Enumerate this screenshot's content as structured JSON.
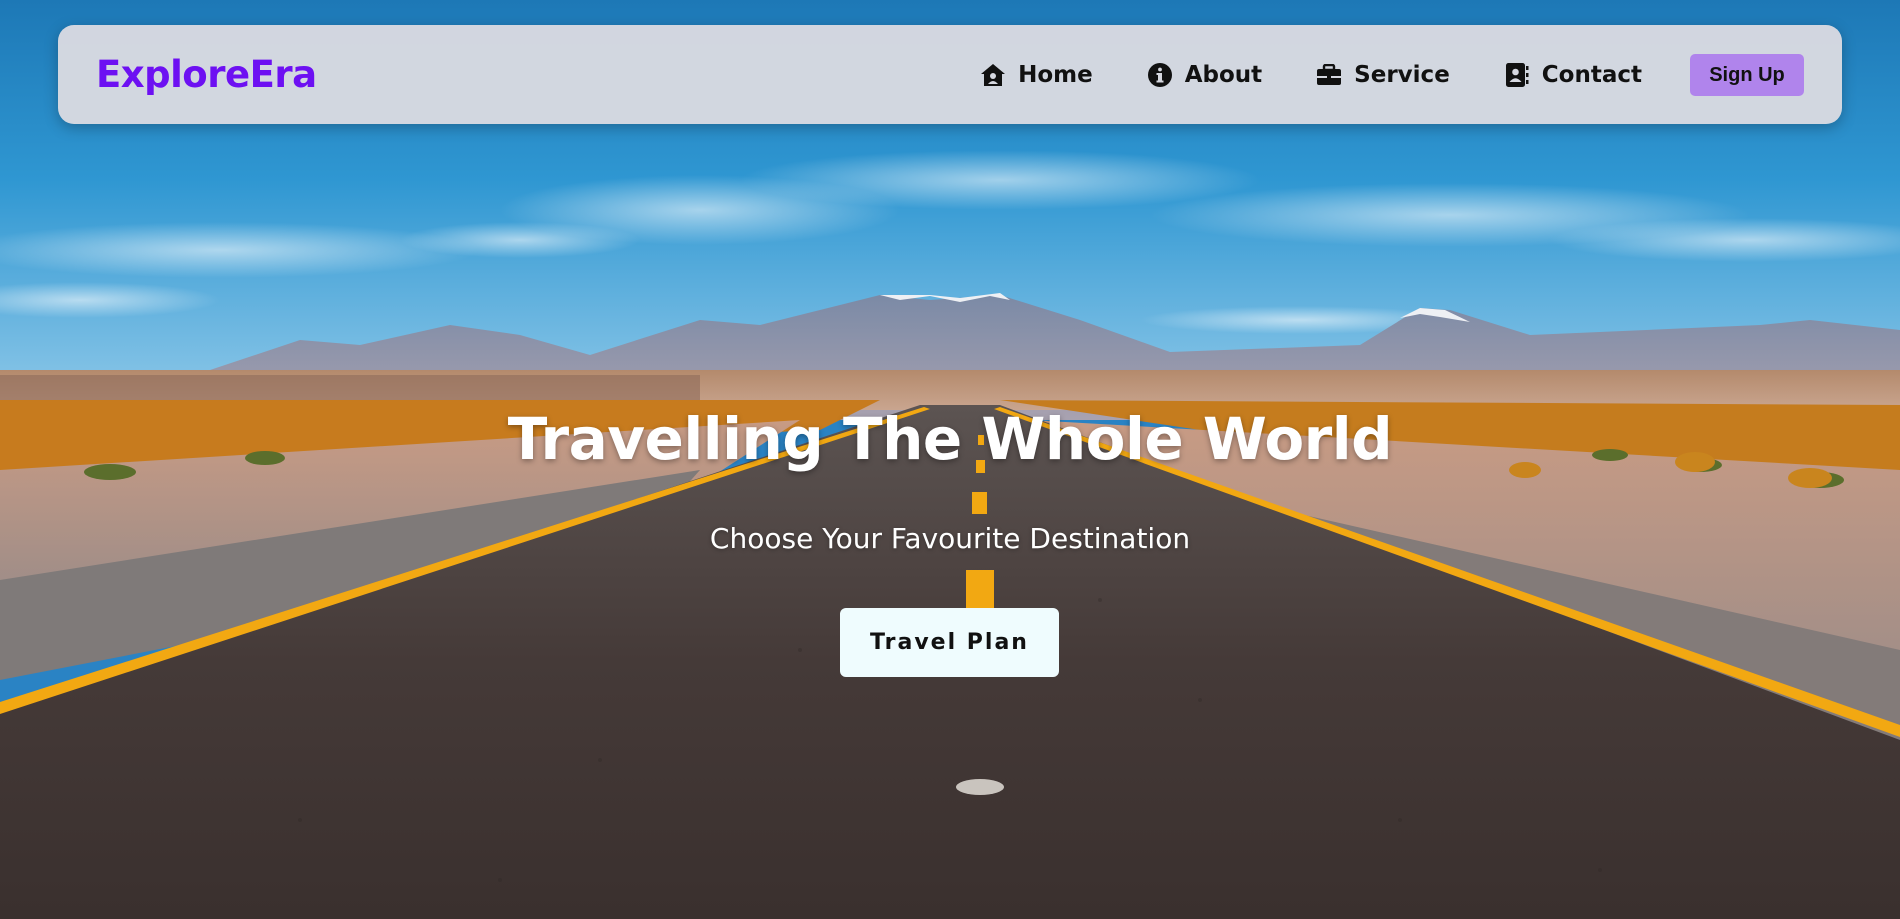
{
  "navbar": {
    "brand": "ExploreEra",
    "links": [
      {
        "label": "Home",
        "icon": "home-icon"
      },
      {
        "label": "About",
        "icon": "info-icon"
      },
      {
        "label": "Service",
        "icon": "briefcase-icon"
      },
      {
        "label": "Contact",
        "icon": "contact-book-icon"
      }
    ],
    "signup_label": "Sign Up"
  },
  "hero": {
    "title": "Travelling The Whole World",
    "subtitle": "Choose Your Favourite Destination",
    "cta_label": "Travel Plan"
  },
  "colors": {
    "brand": "#6d10f2",
    "signup_bg": "#b084ec",
    "navbar_bg": "#d6d8e0",
    "cta_bg": "#effcfe",
    "road_line": "#f2a812"
  }
}
